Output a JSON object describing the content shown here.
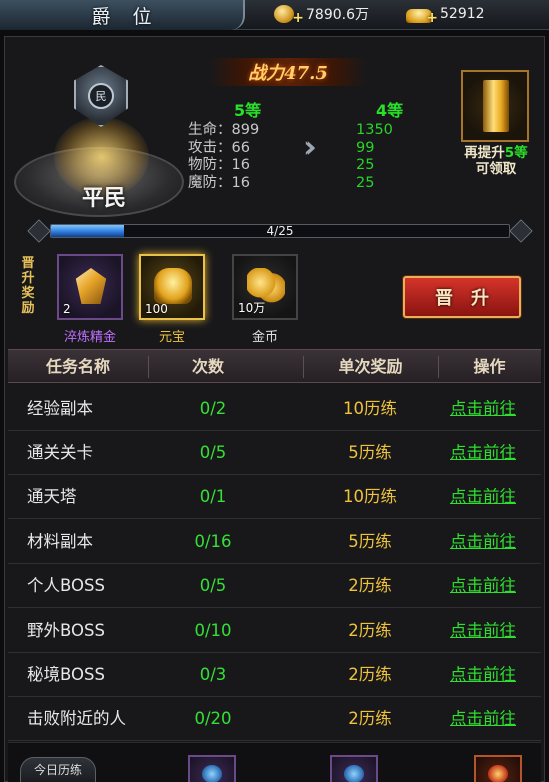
{
  "header": {
    "title": "爵位",
    "coins": "7890.6万",
    "ingots": "52912"
  },
  "rank": {
    "emblem_char": "民",
    "name": "平民",
    "power_text": "战力47.5"
  },
  "levels": {
    "current": "5等",
    "next": "4等"
  },
  "stats": {
    "current": [
      {
        "label": "生命：",
        "value": "899"
      },
      {
        "label": "攻击：",
        "value": "66"
      },
      {
        "label": "物防：",
        "value": "16"
      },
      {
        "label": "魔防：",
        "value": "16"
      }
    ],
    "next": [
      "1350",
      "99",
      "25",
      "25"
    ]
  },
  "next_reward": {
    "line1_prefix": "再提升",
    "line1_highlight": "5等",
    "line2": "可领取"
  },
  "progress": {
    "text": "4/25",
    "value": 4,
    "max": 25
  },
  "promo_rewards": {
    "label": "晋升奖励",
    "items": [
      {
        "name": "淬炼精金",
        "count": "2",
        "name_color": "#c070ff"
      },
      {
        "name": "元宝",
        "count": "100",
        "name_color": "#f0c33c"
      },
      {
        "name": "金币",
        "count": "10万",
        "name_color": "#e0e0e0"
      }
    ]
  },
  "promote_button": "晋升",
  "table": {
    "headers": [
      "任务名称",
      "次数",
      "单次奖励",
      "操作"
    ],
    "rows": [
      {
        "name": "经验副本",
        "times": "0/2",
        "reward": "10历练",
        "action": "点击前往"
      },
      {
        "name": "通关关卡",
        "times": "0/5",
        "reward": "5历练",
        "action": "点击前往"
      },
      {
        "name": "通天塔",
        "times": "0/1",
        "reward": "10历练",
        "action": "点击前往"
      },
      {
        "name": "材料副本",
        "times": "0/16",
        "reward": "5历练",
        "action": "点击前往"
      },
      {
        "name": "个人BOSS",
        "times": "0/5",
        "reward": "2历练",
        "action": "点击前往"
      },
      {
        "name": "野外BOSS",
        "times": "0/10",
        "reward": "2历练",
        "action": "点击前往"
      },
      {
        "name": "秘境BOSS",
        "times": "0/3",
        "reward": "2历练",
        "action": "点击前往"
      },
      {
        "name": "击败附近的人",
        "times": "0/20",
        "reward": "2历练",
        "action": "点击前往"
      }
    ]
  },
  "bottom": {
    "today_label": "今日历练"
  },
  "icons": {
    "coin": "gold-coin-icon",
    "ingot": "gold-ingot-icon",
    "arrow": "double-chevron-right-icon",
    "gold_bar": "gold-bar-icon"
  }
}
